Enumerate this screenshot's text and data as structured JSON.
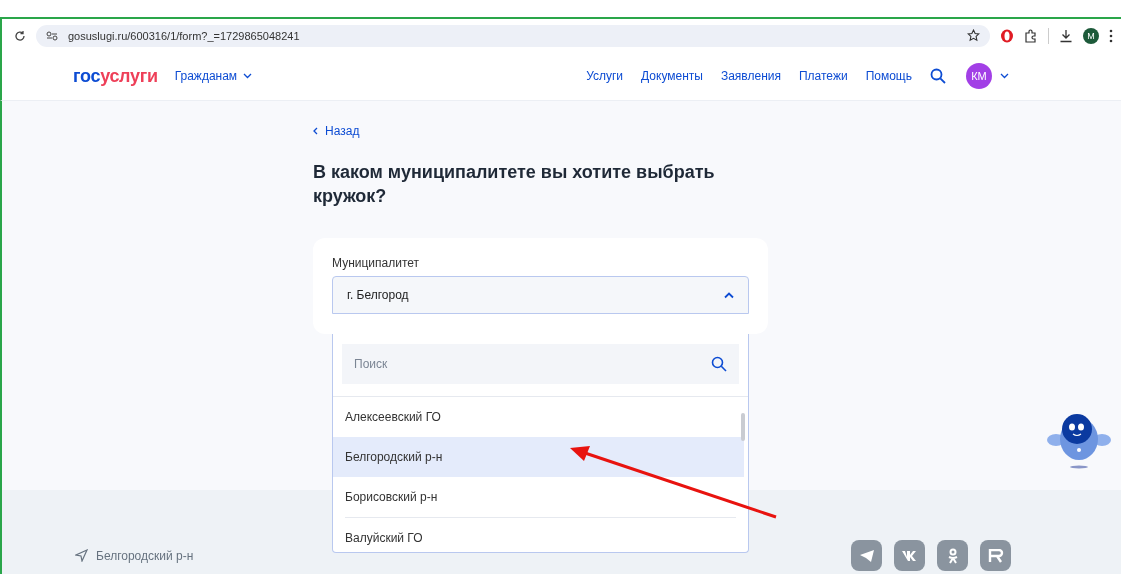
{
  "browser": {
    "url": "gosuslugi.ru/600316/1/form?_=1729865048241",
    "profile_initial": "M"
  },
  "header": {
    "logo_parts": [
      "гос",
      "услуги"
    ],
    "audience_menu": "Гражданам",
    "nav": [
      "Услуги",
      "Документы",
      "Заявления",
      "Платежи",
      "Помощь"
    ],
    "avatar_initials": "КМ"
  },
  "back_link": "Назад",
  "title": "В каком муниципалитете вы хотите выбрать кружок?",
  "field": {
    "label": "Муниципалитет",
    "value": "г. Белгород",
    "expanded": true
  },
  "dropdown": {
    "search_placeholder": "Поиск",
    "options": [
      {
        "label": "Алексеевский ГО",
        "selected": false
      },
      {
        "label": "Белгородский р-н",
        "selected": true
      },
      {
        "label": "Борисовский р-н",
        "selected": false
      },
      {
        "label": "Валуйский ГО",
        "selected": false
      }
    ]
  },
  "footer": {
    "location": "Белгородский р-н"
  }
}
